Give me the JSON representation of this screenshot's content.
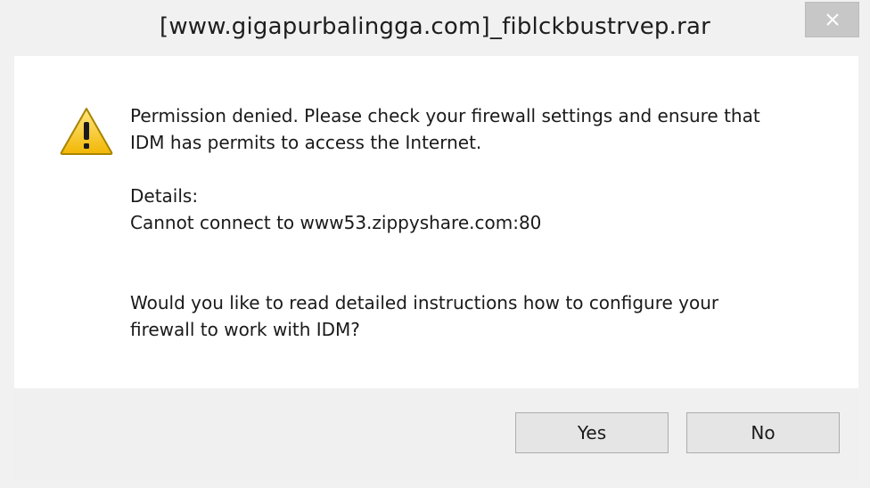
{
  "window": {
    "title": "[www.gigapurbalingga.com]_fiblckbustrvep.rar",
    "close_icon": "close-icon"
  },
  "message": {
    "icon": "warning-icon",
    "line1": "Permission denied. Please check your firewall settings and ensure that",
    "line2": "IDM has permits to access the Internet.",
    "details_label": "Details:",
    "details_text": "Cannot connect to www53.zippyshare.com:80",
    "question_line1": "Would you like to read detailed instructions how to configure your",
    "question_line2": "firewall to work with IDM?"
  },
  "buttons": {
    "yes": "Yes",
    "no": "No"
  }
}
